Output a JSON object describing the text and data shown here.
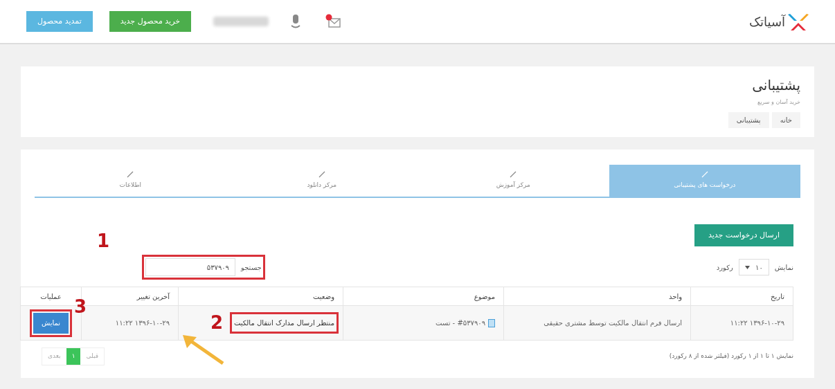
{
  "header": {
    "logo_text": "آسیاتک",
    "buttons": [
      {
        "label": "خرید محصول جدید",
        "kind": "buy"
      },
      {
        "label": "تمدید محصول",
        "kind": "renew"
      }
    ]
  },
  "page": {
    "title": "پشتیبانی",
    "subtitle": "خرید آسان و سریع",
    "breadcrumbs": [
      "خانه",
      "پشتیبانی"
    ]
  },
  "tabs": [
    {
      "label": "درخواست های پشتیبانی",
      "selected": true
    },
    {
      "label": "مرکز آموزش",
      "selected": false
    },
    {
      "label": "مرکز دانلود",
      "selected": false
    },
    {
      "label": "اطلاعات",
      "selected": false
    }
  ],
  "new_request_button": "ارسال درخواست جدید",
  "length_control": {
    "before": "نمایش",
    "value": "۱۰",
    "after": "رکورد"
  },
  "search": {
    "label": "جستجو",
    "value": "۵۳۷۹۰۹",
    "annotation": "1"
  },
  "table": {
    "columns": [
      "تاریخ",
      "واحد",
      "موضوع",
      "وضعیت",
      "آخرین تغییر",
      "عملیات"
    ],
    "rows": [
      {
        "date": "۱۳۹۶-۱۰-۲۹ ۱۱:۲۲",
        "unit": "ارسال فرم انتقال مالکیت توسط مشتری حقیقی",
        "subject": "#۵۳۷۹۰۹ - تست",
        "status": "منتظر ارسال مدارک انتقال مالکیت",
        "status_annotation": "2",
        "last_change": "۱۳۹۶-۱۰-۲۹ ۱۱:۲۲",
        "action": "نمایش",
        "action_annotation": "3"
      }
    ]
  },
  "info": "نمایش ۱ تا ۱ از ۱ رکورد (فیلتر شده از ۸ رکورد)",
  "pagination": [
    {
      "label": "قبلی",
      "selected": false
    },
    {
      "label": "۱",
      "selected": true
    },
    {
      "label": "بعدی",
      "selected": false
    }
  ]
}
